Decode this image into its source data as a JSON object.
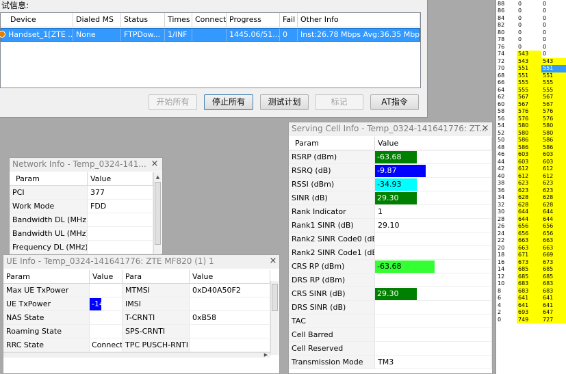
{
  "top_dialog": {
    "caption": "试信息:",
    "columns": [
      "Device",
      "Dialed MS",
      "Status",
      "Times",
      "Connect",
      "Progress",
      "Fail",
      "Other Info"
    ],
    "row": {
      "device": "Handset_1[ZTE ...",
      "dialed_ms": "None",
      "status": "FTPDow...",
      "times": "1/INF",
      "connect": "",
      "progress": "1445.06/51...",
      "fail": "0",
      "other_info": "Inst:26.78 Mbps  Avg:36.35 Mbps"
    },
    "buttons": {
      "start_all": "开始所有",
      "stop_all": "停止所有",
      "test_plan": "测试计划",
      "mark": "标记",
      "at_cmd": "AT指令"
    }
  },
  "network_info": {
    "title": "Network Info - Temp_0324-141...",
    "headers": [
      "Param",
      "Value"
    ],
    "rows": [
      {
        "param": "PCI",
        "value": "377"
      },
      {
        "param": "Work Mode",
        "value": "FDD"
      },
      {
        "param": "Bandwidth DL (MHz)",
        "value": ""
      },
      {
        "param": "Bandwidth UL (MHz)",
        "value": ""
      },
      {
        "param": "Frequency DL (MHz)",
        "value": ""
      }
    ]
  },
  "ue_info": {
    "title": "UE Info - Temp_0324-141641776: ZTE MF820 (1) 1",
    "headers": [
      "Param",
      "Value",
      "Para",
      "Value"
    ],
    "rows": [
      {
        "param": "Max UE TxPower",
        "value": "",
        "para": "MTMSI",
        "value2": "0xD40A50F2"
      },
      {
        "param": "UE TxPower",
        "value": "-14",
        "para": "IMSI",
        "value2": ""
      },
      {
        "param": "NAS State",
        "value": "",
        "para": "T-CRNTI",
        "value2": "0xB58"
      },
      {
        "param": "Roaming State",
        "value": "",
        "para": "SPS-CRNTI",
        "value2": ""
      },
      {
        "param": "RRC State",
        "value": "Connect",
        "para": "TPC PUSCH-RNTI",
        "value2": ""
      }
    ],
    "tx_level": 0.35
  },
  "serving_cell": {
    "title": "Serving Cell Info - Temp_0324-141641776: ZT...",
    "headers": [
      "Param",
      "Value"
    ],
    "rows": [
      {
        "param": "RSRP (dBm)",
        "value": "-63.68",
        "bar_color": "#008000",
        "level": 0.7
      },
      {
        "param": "RSRQ (dB)",
        "value": "-9.87",
        "bar_color": "#0000ff",
        "level": 0.85
      },
      {
        "param": "RSSI (dBm)",
        "value": "-34.93",
        "bar_color": "#00ffff",
        "level": 0.7
      },
      {
        "param": "SINR (dB)",
        "value": "29.30",
        "bar_color": "#008000",
        "level": 0.7
      },
      {
        "param": "Rank Indicator",
        "value": "1",
        "bar_color": "",
        "level": 0
      },
      {
        "param": "Rank1 SINR (dB)",
        "value": "29.10",
        "bar_color": "",
        "level": 0
      },
      {
        "param": "Rank2 SINR Code0 (dB)",
        "value": "",
        "bar_color": "",
        "level": 0
      },
      {
        "param": "Rank2 SINR Code1 (dB)",
        "value": "",
        "bar_color": "",
        "level": 0
      },
      {
        "param": "CRS RP (dBm)",
        "value": "-63.68",
        "bar_color": "#33ff33",
        "level": 1.0
      },
      {
        "param": "DRS RP (dBm)",
        "value": "",
        "bar_color": "",
        "level": 0
      },
      {
        "param": "CRS SINR (dB)",
        "value": "29.30",
        "bar_color": "#008000",
        "level": 0.7
      },
      {
        "param": "DRS SINR (dB)",
        "value": "",
        "bar_color": "",
        "level": 0
      },
      {
        "param": "TAC",
        "value": "",
        "bar_color": "",
        "level": 0
      },
      {
        "param": "Cell Barred",
        "value": "",
        "bar_color": "",
        "level": 0
      },
      {
        "param": "Cell Reserved",
        "value": "",
        "bar_color": "",
        "level": 0
      },
      {
        "param": "Transmission Mode",
        "value": "TM3",
        "bar_color": "",
        "level": 0
      }
    ]
  },
  "right_list": {
    "rows": [
      [
        "88",
        "0",
        "0"
      ],
      [
        "86",
        "0",
        "0"
      ],
      [
        "84",
        "0",
        "0"
      ],
      [
        "82",
        "0",
        "0"
      ],
      [
        "80",
        "0",
        "0"
      ],
      [
        "78",
        "0",
        "0"
      ],
      [
        "76",
        "0",
        "0"
      ],
      [
        "74",
        "543",
        "0"
      ],
      [
        "72",
        "543",
        "543"
      ],
      [
        "70",
        "551",
        "551"
      ],
      [
        "68",
        "551",
        "551"
      ],
      [
        "66",
        "555",
        "555"
      ],
      [
        "64",
        "555",
        "555"
      ],
      [
        "62",
        "567",
        "567"
      ],
      [
        "60",
        "567",
        "567"
      ],
      [
        "58",
        "576",
        "576"
      ],
      [
        "56",
        "576",
        "576"
      ],
      [
        "54",
        "580",
        "580"
      ],
      [
        "52",
        "580",
        "580"
      ],
      [
        "50",
        "586",
        "586"
      ],
      [
        "48",
        "586",
        "586"
      ],
      [
        "46",
        "603",
        "603"
      ],
      [
        "44",
        "603",
        "603"
      ],
      [
        "42",
        "612",
        "612"
      ],
      [
        "40",
        "612",
        "612"
      ],
      [
        "38",
        "623",
        "623"
      ],
      [
        "36",
        "623",
        "623"
      ],
      [
        "34",
        "628",
        "628"
      ],
      [
        "32",
        "628",
        "628"
      ],
      [
        "30",
        "644",
        "644"
      ],
      [
        "28",
        "644",
        "644"
      ],
      [
        "26",
        "656",
        "656"
      ],
      [
        "24",
        "656",
        "656"
      ],
      [
        "22",
        "663",
        "663"
      ],
      [
        "20",
        "663",
        "663"
      ],
      [
        "18",
        "671",
        "669"
      ],
      [
        "16",
        "673",
        "673"
      ],
      [
        "14",
        "685",
        "685"
      ],
      [
        "12",
        "685",
        "685"
      ],
      [
        "10",
        "683",
        "683"
      ],
      [
        "8",
        "683",
        "683"
      ],
      [
        "6",
        "641",
        "641"
      ],
      [
        "4",
        "641",
        "641"
      ],
      [
        "2",
        "693",
        "647"
      ],
      [
        "0",
        "749",
        "727"
      ]
    ],
    "highlight_color": "#ffff00",
    "selected_color": "#3399ff"
  }
}
